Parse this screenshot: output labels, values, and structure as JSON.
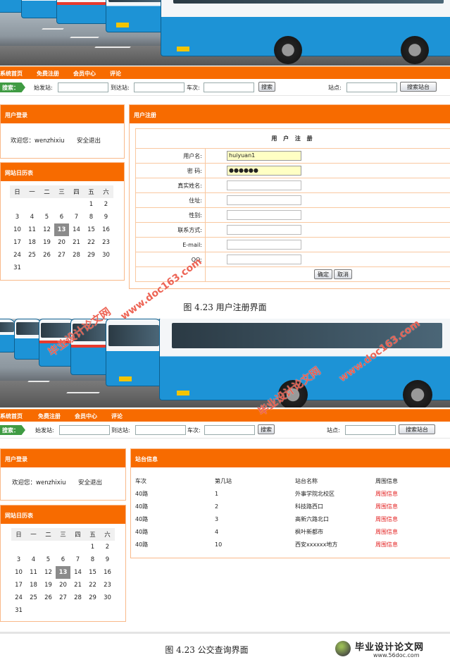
{
  "nav": {
    "items": [
      "系统首页",
      "免费注册",
      "会员中心",
      "评论"
    ]
  },
  "search": {
    "tag": "搜索：",
    "from_label": "始发站:",
    "to_label": "到达站:",
    "line_label": "车次:",
    "search_button": "搜索",
    "station_label": "站点:",
    "station_button": "搜索站台"
  },
  "login": {
    "title": "用户登录",
    "welcome": "欢迎您：",
    "username": "wenzhixiu",
    "logout": "安全退出"
  },
  "calendar": {
    "title": "网站日历表",
    "weekdays": [
      "日",
      "一",
      "二",
      "三",
      "四",
      "五",
      "六"
    ],
    "weeks": [
      [
        "",
        "",
        "",
        "",
        "",
        "1",
        "2"
      ],
      [
        "3",
        "4",
        "5",
        "6",
        "7",
        "8",
        "9"
      ],
      [
        "10",
        "11",
        "12",
        "13",
        "14",
        "15",
        "16"
      ],
      [
        "17",
        "18",
        "19",
        "20",
        "21",
        "22",
        "23"
      ],
      [
        "24",
        "25",
        "26",
        "27",
        "28",
        "29",
        "30"
      ],
      [
        "31",
        "",
        "",
        "",
        "",
        "",
        ""
      ]
    ],
    "today": "13"
  },
  "register": {
    "panel_title": "用户注册",
    "form_title": "用 户 注 册",
    "fields": [
      {
        "label": "用户名:",
        "value": "huiyuan1"
      },
      {
        "label": "密  码:",
        "value": "●●●●●●"
      },
      {
        "label": "真实姓名:",
        "value": ""
      },
      {
        "label": "住址:",
        "value": ""
      },
      {
        "label": "性别:",
        "value": ""
      },
      {
        "label": "联系方式:",
        "value": ""
      },
      {
        "label": "E-mail:",
        "value": ""
      },
      {
        "label": "QQ:",
        "value": ""
      }
    ],
    "confirm": "确定",
    "cancel": "取消"
  },
  "station": {
    "panel_title": "站台信息",
    "headers": [
      "车次",
      "第几站",
      "站台名称",
      "周围信息"
    ],
    "rows": [
      [
        "40路",
        "1",
        "外事学院北校区",
        "周围信息"
      ],
      [
        "40路",
        "2",
        "科技路西口",
        "周围信息"
      ],
      [
        "40路",
        "3",
        "高新六路北口",
        "周围信息"
      ],
      [
        "40路",
        "4",
        "枫叶新都市",
        "周围信息"
      ],
      [
        "40路",
        "10",
        "西安xxxxxx地方",
        "周围信息"
      ]
    ]
  },
  "captions": {
    "top": "图 4.23 用户注册界面",
    "bottom": "图 4.23 公交查询界面"
  },
  "watermarks": {
    "site": "www.doc163.com",
    "cn": "毕业设计论文网"
  },
  "logo": {
    "title": "毕业设计论文网",
    "url": "www.56doc.com"
  },
  "colors": {
    "nav": "#f76b00",
    "panel_border": "#f9b98a",
    "link_red": "#e32121",
    "search_tag": "#3f9b43"
  }
}
